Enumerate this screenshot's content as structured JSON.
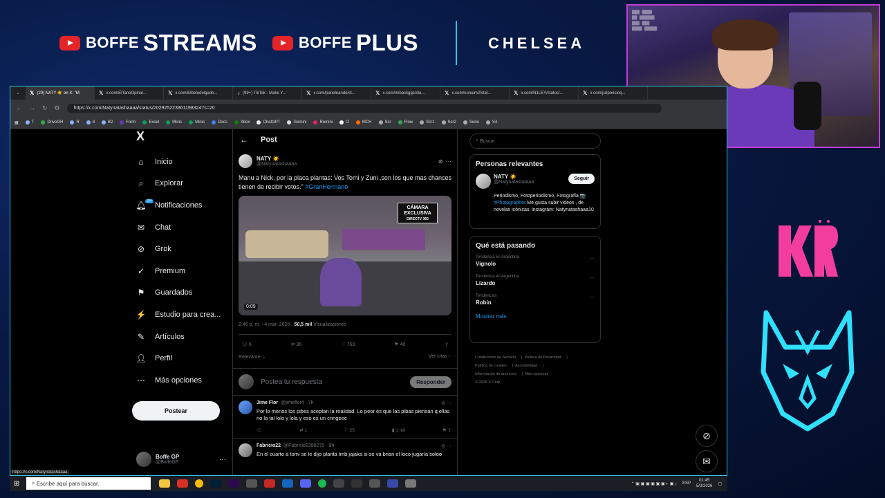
{
  "overlay": {
    "brand1_small": "BOFFE",
    "brand1_big": "STREAMS",
    "brand2_small": "BOFFE",
    "brand2_big": "PLUS",
    "sponsor": "CHELSEA",
    "logo_text": "KRÜ"
  },
  "browser": {
    "tabs": [
      "(20) NATY ☀️ en X: \"M",
      "x.com/ElTanoOpina/...",
      "x.com/Elbetodelgado...",
      "(99+) TikTok - Make Y...",
      "x.com/paneleando/st...",
      "x.com/imbackggs/sta...",
      "x.com/nunuim2/stat...",
      "x.com/N1LEY/status/...",
      "x.com/juliponcioq..."
    ],
    "url": "https://x.com/Natynatashaaaa/status/2029252238611983247s=20",
    "bookmarks": [
      "T",
      "DriveGH",
      "R",
      "8",
      "B2",
      "Form",
      "Excel",
      "Minis",
      "Minis",
      "Docs",
      "Xbox",
      "ChatGPT",
      "Gemini",
      "Remini",
      "O",
      "MCH",
      "Scr",
      "Flow",
      "Scr1",
      "Scr2",
      "Serie",
      "S4"
    ],
    "status_url": "https://x.com/Natynatashaaaa"
  },
  "sidebar": {
    "logo": "X",
    "items": [
      {
        "label": "Inicio",
        "icon": "home-icon"
      },
      {
        "label": "Explorar",
        "icon": "search-icon"
      },
      {
        "label": "Notificaciones",
        "icon": "bell-icon",
        "badge": "20+"
      },
      {
        "label": "Chat",
        "icon": "mail-icon"
      },
      {
        "label": "Grok",
        "icon": "grok-icon"
      },
      {
        "label": "Premium",
        "icon": "premium-icon"
      },
      {
        "label": "Guardados",
        "icon": "bookmark-icon"
      },
      {
        "label": "Estudio para crea...",
        "icon": "studio-icon"
      },
      {
        "label": "Artículos",
        "icon": "article-icon"
      },
      {
        "label": "Perfil",
        "icon": "person-icon"
      },
      {
        "label": "Más opciones",
        "icon": "more-circle-icon"
      }
    ],
    "post_button": "Postear",
    "profile_name": "Boffe GP",
    "profile_handle": "@BoffeGP"
  },
  "post": {
    "header": "Post",
    "author_name": "NATY ☀️",
    "author_handle": "@Natynatashaaaa",
    "text": "Manu a Nick, por la placa plantas: Vos  Tomi y Zuni ,son los que mas chances tienen de recibir votos.\"",
    "hashtag": "#GranHermano",
    "media_badge": "CÁMARA EXCLUSIVA",
    "media_badge_sub": "DIRECTV 360",
    "media_time": "0:09",
    "timestamp": "2:46 p. m. · 4 mar. 2026 ·",
    "views_count": "50,5 mil",
    "views_label": "Visualizaciones",
    "replies": "6",
    "reposts": "36",
    "likes": "763",
    "bookmarks": "48",
    "sort_label": "Relevante",
    "quotes_label": "Ver citas",
    "reply_placeholder": "Postea tu respuesta",
    "reply_button": "Responder"
  },
  "replies": [
    {
      "name": "Jime Flor",
      "handle": "@jimeflor4 · 7h",
      "text": "Por lo menos los pibes aceptan la realidad. Lo peor es que las pibas piensan q ellas no la tal lolo y lola y eso es un cringeee",
      "replies": "",
      "reposts": "1",
      "likes": "25",
      "views": "1 mil"
    },
    {
      "name": "Fabricio22",
      "handle": "@Fabricio2288270 · 9h",
      "text": "En el  cuarto a tomi se le dijo planta tmb jajaka si se va brian el loco jugaría soloo"
    }
  ],
  "right": {
    "search_placeholder": "Buscar",
    "relevant_title": "Personas relevantes",
    "relevant_name": "NATY ☀️",
    "relevant_handle": "@Natynatashaaaa",
    "follow_label": "Seguir",
    "bio_pre": "Periodismo, Fotoperiodismo, Fotografía 📷",
    "bio_tag": "#Photographer",
    "bio_post": "Me gusta subir videos , de novelas icónicas. instagram: Natynatashaaa10",
    "trends_title": "Qué está pasando",
    "trends": [
      {
        "category": "Tendencia en Argentina",
        "name": "Vignolo"
      },
      {
        "category": "Tendencia en Argentina",
        "name": "Lizardo"
      },
      {
        "category": "Tendencias",
        "name": "Robin"
      }
    ],
    "show_more": "Mostrar más",
    "footer": [
      "Condiciones de Servicio",
      "Política de Privacidad",
      "Política de cookies",
      "Accesibilidad",
      "Información de anuncios",
      "Más opciones ···",
      "© 2026 X Corp."
    ]
  },
  "taskbar": {
    "search_placeholder": "Escribe aquí para buscar.",
    "lang": "ESP",
    "time": "01:45",
    "date": "5/3/2026"
  },
  "colors": {
    "accent_blue": "#1d9bf0",
    "frame_cyan": "#2ec4e8",
    "webcam_border": "#c23bd8",
    "logo_pink": "#ff3fa4",
    "youtube_red": "#e3252a"
  }
}
